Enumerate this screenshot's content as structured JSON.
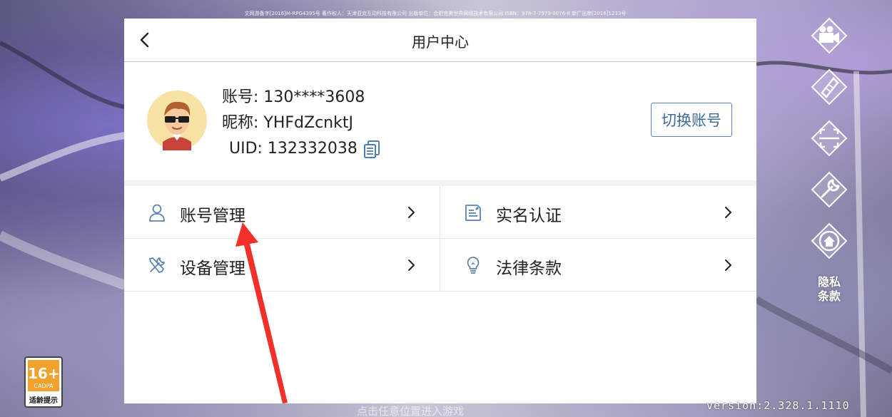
{
  "top_notice": "文网游备字[2016]M-RPG4395号 著作权人：天津亚克互动科技有限公司 出版单位：合肥完美世界网络技术有限公司 ISBN：978-7-7979-0076-8 新广出审[2016]1233号",
  "header": {
    "title": "用户中心"
  },
  "profile": {
    "account_label": "账号: 130****3608",
    "nickname_label": "昵称: YHFdZcnktJ",
    "uid_label": "UID: 132332038",
    "switch_button": "切换账号"
  },
  "menu": {
    "items": [
      {
        "label": "账号管理",
        "icon": "user-icon"
      },
      {
        "label": "实名认证",
        "icon": "id-card-icon"
      },
      {
        "label": "设备管理",
        "icon": "wrench-screwdriver-icon"
      },
      {
        "label": "法律条款",
        "icon": "lightbulb-icon"
      }
    ]
  },
  "side": {
    "icons": [
      "video-camera-icon",
      "pencil-ruler-icon",
      "fullscreen-icon",
      "wrench-icon",
      "home-icon"
    ],
    "privacy_line1": "隐私",
    "privacy_line2": "条款"
  },
  "age_badge": {
    "rating": "16+",
    "org": "CADPA",
    "text": "适龄提示"
  },
  "version": "version:2.328.1.1110",
  "bottom_hint": "点击任意位置进入游戏",
  "colors": {
    "accent_blue": "#5d84b0",
    "arrow_red": "#f2302a",
    "age_orange": "#f2a12b"
  }
}
